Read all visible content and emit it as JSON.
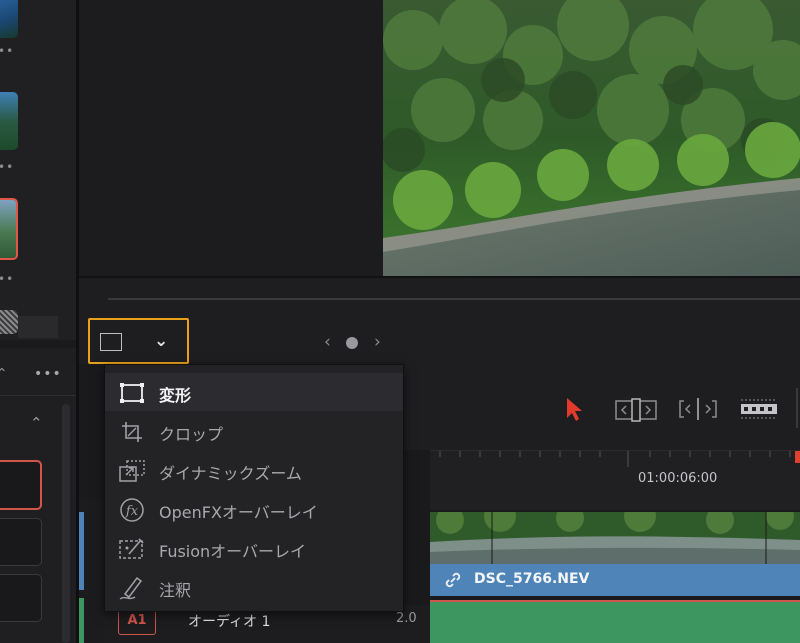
{
  "viewer": {
    "overlay_selector": {
      "mode_icon": "transform-icon",
      "dropdown_icon": "chevron-down-icon"
    },
    "frame_nav": {
      "prev": "‹",
      "next": "›"
    }
  },
  "overlay_menu": {
    "items": [
      {
        "label": "変形",
        "icon": "transform-icon",
        "selected": true
      },
      {
        "label": "クロップ",
        "icon": "crop-icon",
        "selected": false
      },
      {
        "label": "ダイナミックズーム",
        "icon": "dynamic-zoom-icon",
        "selected": false
      },
      {
        "label": "OpenFXオーバーレイ",
        "icon": "openfx-icon",
        "selected": false
      },
      {
        "label": "Fusionオーバーレイ",
        "icon": "fusion-icon",
        "selected": false
      },
      {
        "label": "注釈",
        "icon": "annotation-pen-icon",
        "selected": false
      }
    ]
  },
  "media_pool": {
    "more_label": "•••"
  },
  "timeline": {
    "timecode": "01:00:06:00",
    "clip_name": "DSC_5766.NEV",
    "audio_track": {
      "id": "A1",
      "name": "オーディオ 1",
      "channel": "2.0"
    },
    "tools": [
      "selection-arrow-icon",
      "trim-icon",
      "dynamic-trim-icon",
      "blade-icon"
    ]
  },
  "colors": {
    "highlight": "#e8a21a",
    "clip_blue": "#4e84b8",
    "audio_green": "#3d9560",
    "playhead_red": "#e0402f"
  }
}
